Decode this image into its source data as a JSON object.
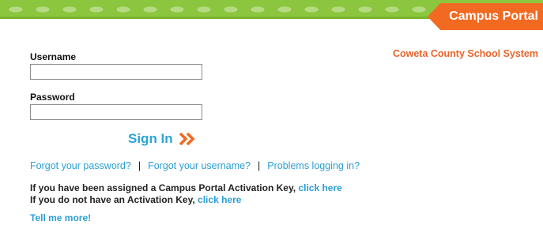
{
  "header": {
    "portal_title": "Campus Portal",
    "district": "Coweta County School System"
  },
  "form": {
    "username_label": "Username",
    "username_value": "",
    "password_label": "Password",
    "password_value": "",
    "signin_label": "Sign In"
  },
  "links": {
    "forgot_password": "Forgot your password?",
    "forgot_username": "Forgot your username?",
    "problems": "Problems logging in?",
    "separator": "|"
  },
  "activation": {
    "line1_text": "If you have been assigned a Campus Portal Activation Key,",
    "line1_link": "click here",
    "line2_text": "If you do not have an Activation Key,",
    "line2_link": "click here",
    "tell_more": "Tell me more!"
  },
  "icons": {
    "signin_arrow": "double-chevron-right-icon"
  },
  "colors": {
    "banner_green": "#8cc63f",
    "tab_orange": "#f26a21",
    "district_orange": "#e8652b",
    "link_blue": "#2a9fd6",
    "signin_blue": "#2aa4d8"
  }
}
